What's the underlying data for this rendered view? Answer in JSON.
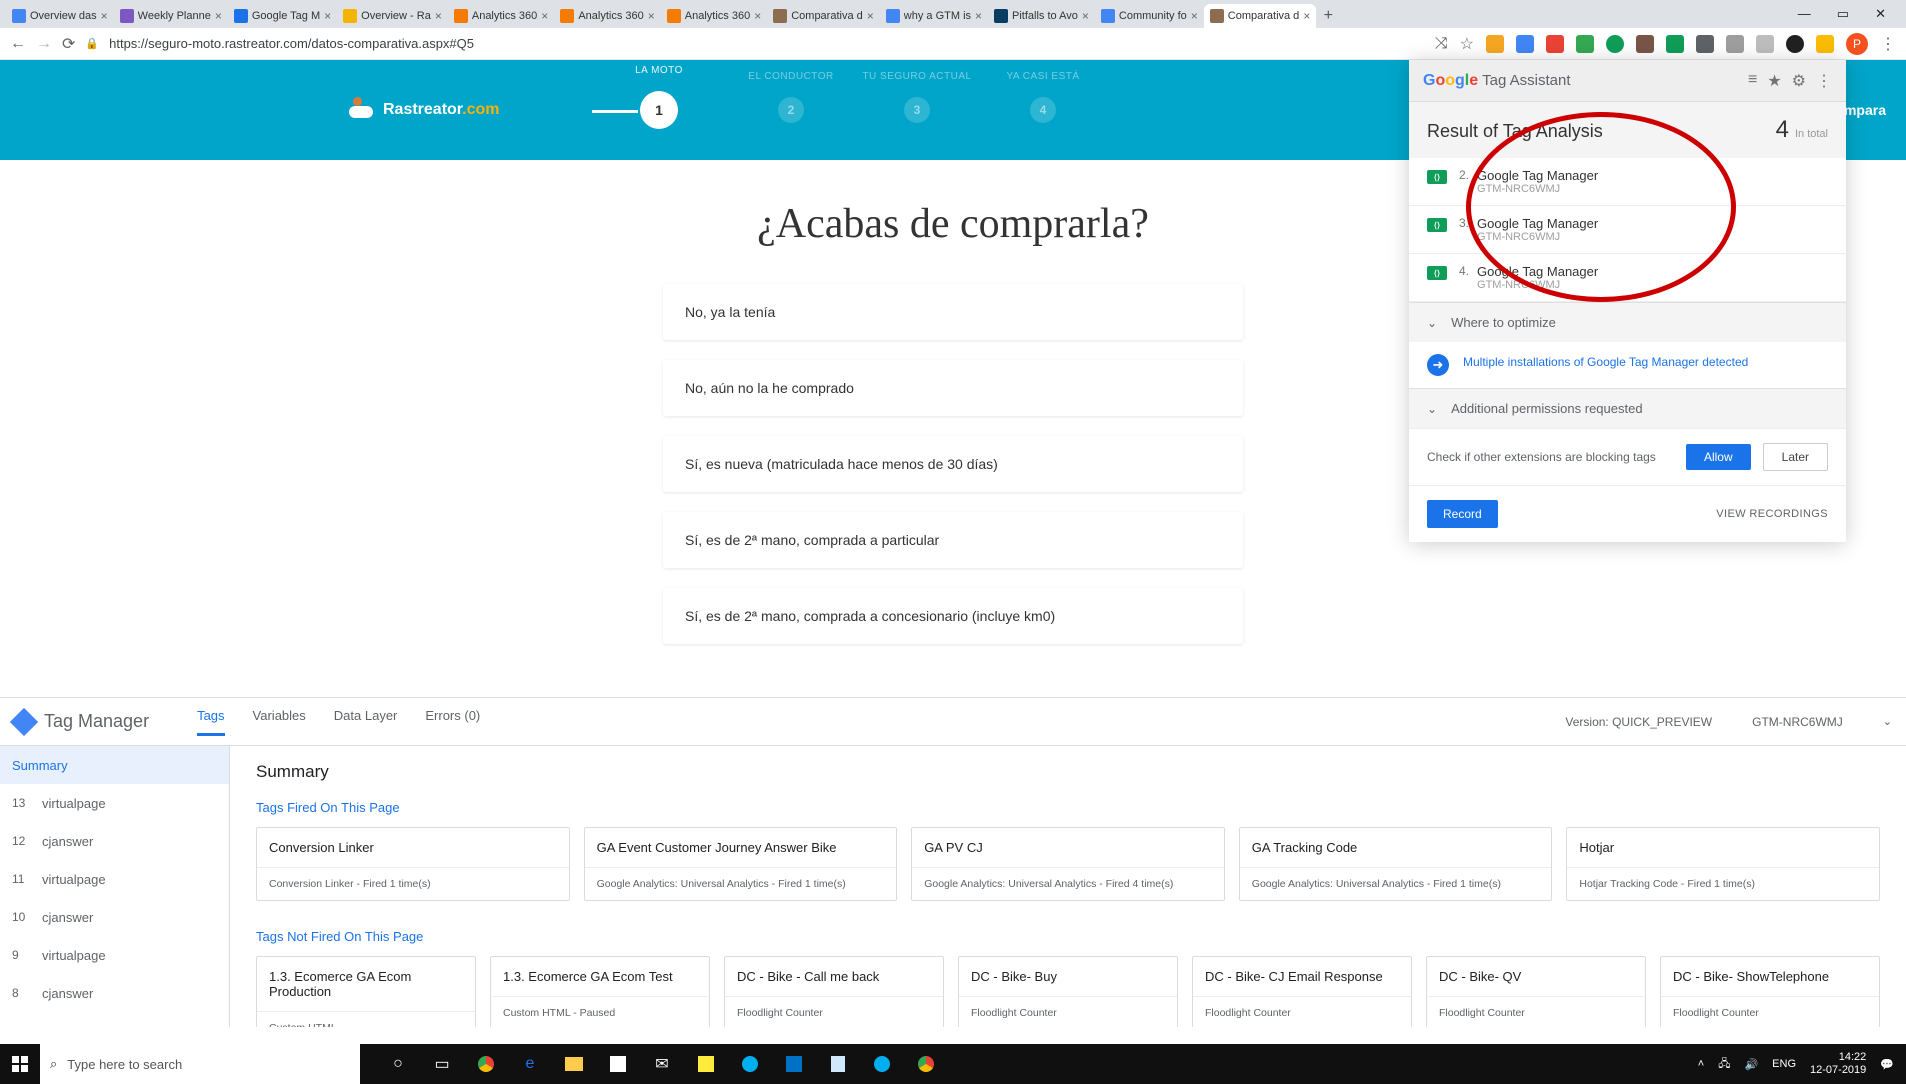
{
  "browser": {
    "tabs": [
      {
        "title": "Overview das",
        "favicon": "#4285f4"
      },
      {
        "title": "Weekly Planne",
        "favicon": "#7e57c2"
      },
      {
        "title": "Google Tag M",
        "favicon": "#1a73e8"
      },
      {
        "title": "Overview - Ra",
        "favicon": "#f4b400"
      },
      {
        "title": "Analytics 360",
        "favicon": "#f57c00"
      },
      {
        "title": "Analytics 360",
        "favicon": "#f57c00"
      },
      {
        "title": "Analytics 360",
        "favicon": "#f57c00"
      },
      {
        "title": "Comparativa d",
        "favicon": "#8c6d4f"
      },
      {
        "title": "why a GTM is",
        "favicon": "#4285f4"
      },
      {
        "title": "Pitfalls to Avo",
        "favicon": "#0a3d62"
      },
      {
        "title": "Community fo",
        "favicon": "#4285f4"
      },
      {
        "title": "Comparativa d",
        "favicon": "#8c6d4f",
        "active": true
      }
    ],
    "url": "https://seguro-moto.rastreator.com/datos-comparativa.aspx#Q5",
    "avatar_letter": "P"
  },
  "rastreator": {
    "brand": "Rastreator",
    "brand_suffix": ".com",
    "steps": [
      {
        "label": "LA MOTO",
        "n": "1",
        "active": true
      },
      {
        "label": "EL CONDUCTOR",
        "n": "2"
      },
      {
        "label": "TU SEGURO ACTUAL",
        "n": "3"
      },
      {
        "label": "YA CASI ESTÁ",
        "n": "4"
      }
    ],
    "right_label": "Compara",
    "question": "¿Acabas de comprarla?",
    "options": [
      "No, ya la tenía",
      "No, aún no la he comprado",
      "Sí, es nueva (matriculada hace menos de 30 días)",
      "Sí, es de 2ª mano, comprada a particular",
      "Sí, es de 2ª mano, comprada a concesionario (incluye km0)"
    ]
  },
  "tag_assistant": {
    "title_google": "Google",
    "title_sub": "Tag Assistant",
    "result_label": "Result of Tag Analysis",
    "count": "4",
    "in_total": "In total",
    "rows": [
      {
        "n": "2.",
        "name": "Google Tag Manager",
        "id": "GTM-NRC6WMJ"
      },
      {
        "n": "3.",
        "name": "Google Tag Manager",
        "id": "GTM-NRC6WMJ"
      },
      {
        "n": "4.",
        "name": "Google Tag Manager",
        "id": "GTM-NRC6WMJ"
      }
    ],
    "optimize": "Where to optimize",
    "issue": "Multiple installations of Google Tag Manager detected",
    "permissions": "Additional permissions requested",
    "check": "Check if other extensions are blocking tags",
    "allow": "Allow",
    "later": "Later",
    "record": "Record",
    "view": "VIEW RECORDINGS"
  },
  "gtm": {
    "product": "Tag Manager",
    "tabs": [
      "Tags",
      "Variables",
      "Data Layer",
      "Errors (0)"
    ],
    "version": "Version: QUICK_PREVIEW",
    "container": "GTM-NRC6WMJ",
    "side": [
      {
        "n": "",
        "label": "Summary",
        "header": true
      },
      {
        "n": "13",
        "label": "virtualpage"
      },
      {
        "n": "12",
        "label": "cjanswer"
      },
      {
        "n": "11",
        "label": "virtualpage"
      },
      {
        "n": "10",
        "label": "cjanswer"
      },
      {
        "n": "9",
        "label": "virtualpage"
      },
      {
        "n": "8",
        "label": "cjanswer"
      }
    ],
    "summary_title": "Summary",
    "fired_title": "Tags Fired On This Page",
    "fired": [
      {
        "name": "Conversion Linker",
        "sub": "Conversion Linker - Fired 1 time(s)"
      },
      {
        "name": "GA Event Customer Journey Answer Bike",
        "sub": "Google Analytics: Universal Analytics - Fired 1 time(s)"
      },
      {
        "name": "GA PV CJ",
        "sub": "Google Analytics: Universal Analytics - Fired 4 time(s)"
      },
      {
        "name": "GA Tracking Code",
        "sub": "Google Analytics: Universal Analytics - Fired 1 time(s)"
      },
      {
        "name": "Hotjar",
        "sub": "Hotjar Tracking Code - Fired 1 time(s)"
      }
    ],
    "notfired_title": "Tags Not Fired On This Page",
    "notfired": [
      {
        "name": "1.3. Ecomerce GA Ecom Production",
        "sub": "Custom HTML"
      },
      {
        "name": "1.3. Ecomerce GA Ecom Test",
        "sub": "Custom HTML - Paused"
      },
      {
        "name": "DC - Bike - Call me back",
        "sub": "Floodlight Counter"
      },
      {
        "name": "DC - Bike- Buy",
        "sub": "Floodlight Counter"
      },
      {
        "name": "DC - Bike- CJ Email Response",
        "sub": "Floodlight Counter"
      },
      {
        "name": "DC - Bike- QV",
        "sub": "Floodlight Counter"
      },
      {
        "name": "DC - Bike- ShowTelephone",
        "sub": "Floodlight Counter"
      }
    ]
  },
  "taskbar": {
    "search_placeholder": "Type here to search",
    "lang": "ENG",
    "time": "14:22",
    "date": "12-07-2019"
  }
}
